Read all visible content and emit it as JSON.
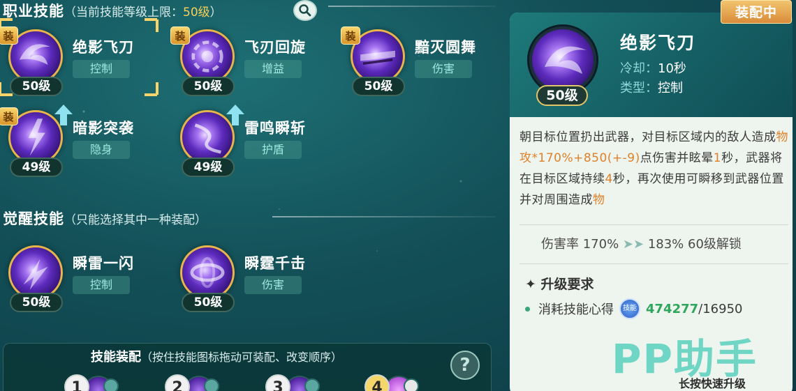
{
  "header": {
    "title": "职业技能",
    "subtitle_prefix": "（当前技能等级上限：",
    "level_cap": "50级",
    "subtitle_suffix": "）"
  },
  "awaken_header": {
    "title": "觉醒技能",
    "subtitle": "（只能选择其中一种装配）"
  },
  "equip_badge": "装",
  "skills": [
    {
      "name": "绝影飞刀",
      "tag": "控制",
      "level": "50级"
    },
    {
      "name": "飞刃回旋",
      "tag": "增益",
      "level": "50级"
    },
    {
      "name": "黯灭圆舞",
      "tag": "伤害",
      "level": "50级"
    },
    {
      "name": "暗影突袭",
      "tag": "隐身",
      "level": "49级"
    },
    {
      "name": "雷鸣瞬斩",
      "tag": "护盾",
      "level": "49级"
    }
  ],
  "awaken_skills": [
    {
      "name": "瞬雷一闪",
      "tag": "控制",
      "level": "50级"
    },
    {
      "name": "瞬霆千击",
      "tag": "伤害",
      "level": "50级"
    }
  ],
  "equip_panel": {
    "title": "技能装配",
    "subtitle": "（按住技能图标拖动可装配、改变顺序）",
    "help": "?",
    "slots": [
      "1",
      "2",
      "3",
      "4"
    ]
  },
  "detail": {
    "status": "装配中",
    "name": "绝影飞刀",
    "level": "50级",
    "cooldown_label": "冷却：",
    "cooldown_value": "10秒",
    "type_label": "类型：",
    "type_value": "控制",
    "desc_1": "朝目标位置扔出武器，对目标区域内的敌人造成",
    "desc_hl_1": "物攻*170%+850(+-9)",
    "desc_2": "点伤害并眩晕",
    "desc_hl_2": "1",
    "desc_3": "秒，武器将在目标区域持续",
    "desc_hl_3": "4",
    "desc_4": "秒，再次使用可瞬移到武器位置并对周围造成",
    "desc_hl_4": "物",
    "rate_label": "伤害率 170%",
    "rate_next": "183% 60级解锁",
    "req_title": "升级要求",
    "req_item": "消耗技能心得",
    "req_coin": "技能",
    "req_have": "474277",
    "req_need": "/16950",
    "quick_upgrade": "长按快速升级"
  },
  "watermark": "PP助手",
  "colors": {
    "accent_gold": "#f6d15a",
    "tag_text": "#9fe8df",
    "highlight_orange": "#e0812a",
    "have_green": "#2ea65b",
    "watermark": "#6fd6c5"
  }
}
